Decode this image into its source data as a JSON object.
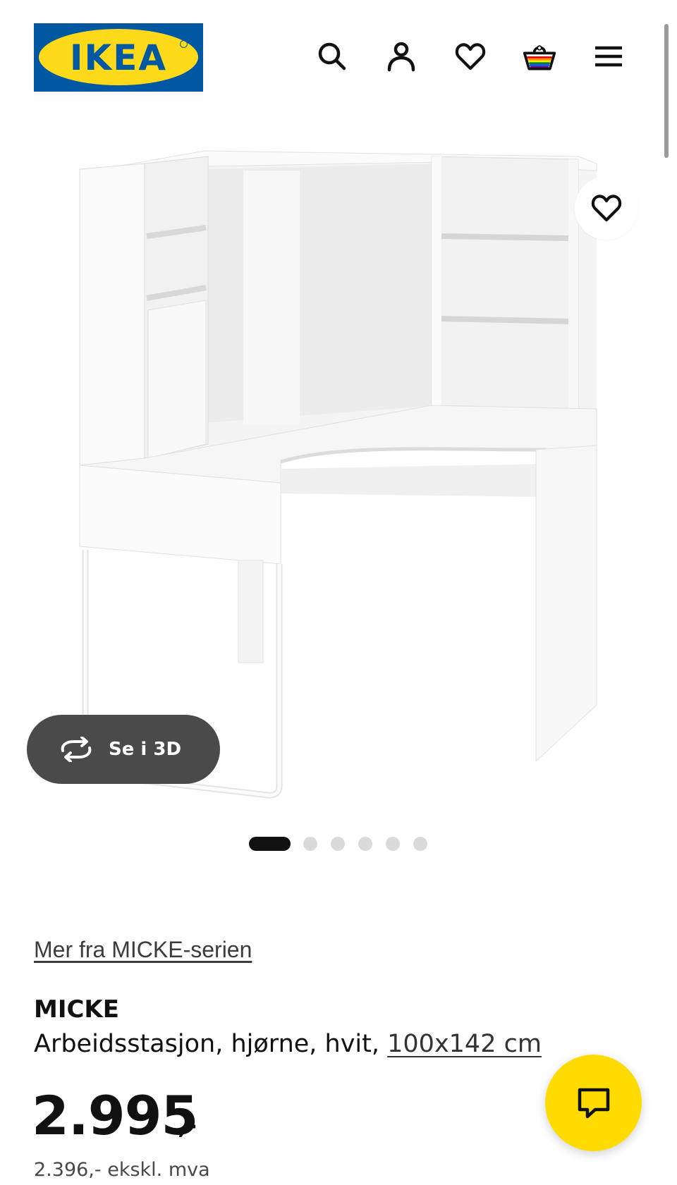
{
  "header": {
    "logo_text": "IKEA",
    "icons": [
      "search-icon",
      "account-icon",
      "wishlist-heart-icon",
      "shopping-basket-icon",
      "hamburger-menu-icon"
    ]
  },
  "gallery": {
    "view_3d_label": "Se i 3D",
    "image_count": 6,
    "active_image": 1
  },
  "product": {
    "series_link": "Mer fra MICKE-serien",
    "name": "MICKE",
    "description": "Arbeidsstasjon, hjørne, hvit,",
    "dimensions": "100x142 cm",
    "price_main": "2.995",
    "price_suffix": ",-",
    "price_excl_vat": "2.396,- ekskl. mva"
  },
  "colors": {
    "ikea_blue": "#0058a3",
    "ikea_yellow": "#ffda1a",
    "chat_yellow": "#ffdb00",
    "button_dark": "#4a4a4a"
  }
}
